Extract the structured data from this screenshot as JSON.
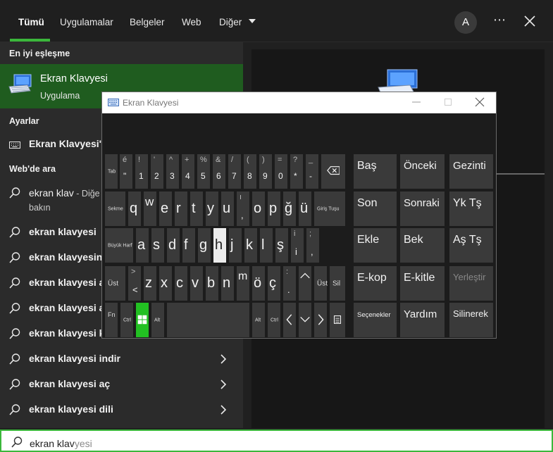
{
  "search": {
    "tabs": [
      "Tümü",
      "Uygulamalar",
      "Belgeler",
      "Web",
      "Diğer"
    ],
    "avatar_letter": "A",
    "more_label": "⋯",
    "best_match_header": "En iyi eşleşme",
    "best_match_title": "Ekran Klavyesi",
    "best_match_subtitle": "Uygulama",
    "settings_header": "Ayarlar",
    "settings_item": "Ekran Klavyesi'n",
    "web_header": "Web'de ara",
    "web_first_query": "ekran klav",
    "web_first_suffix": " - Diğe",
    "web_first_line2": "bakın",
    "web_items": [
      "ekran klavyesi",
      "ekran klavyesini",
      "ekran klavyesi a",
      "ekran klavyesi a",
      "ekran klavyesi k",
      "ekran klavyesi indir",
      "ekran klavyesi aç",
      "ekran klavyesi dili"
    ],
    "input_typed": "ekran klav",
    "input_suggestion": "yesi"
  },
  "osk": {
    "title": "Ekran Klavyesi",
    "rows": {
      "r1": [
        {
          "w": "Tab"
        },
        {
          "m": "\"",
          "s": "é"
        },
        {
          "m": "1",
          "s": "!"
        },
        {
          "m": "2",
          "s": "'"
        },
        {
          "m": "3",
          "s": "^"
        },
        {
          "m": "4",
          "s": "+"
        },
        {
          "m": "5",
          "s": "%"
        },
        {
          "m": "6",
          "s": "&"
        },
        {
          "m": "7",
          "s": "/"
        },
        {
          "m": "8",
          "s": "("
        },
        {
          "m": "9",
          "s": ")"
        },
        {
          "m": "0",
          "s": "="
        },
        {
          "m": "*",
          "s": "?"
        },
        {
          "m": "-",
          "s": "_"
        },
        {
          "icon": "backspace"
        }
      ],
      "r2": [
        {
          "w": "Sekme"
        },
        {
          "m": "q"
        },
        {
          "m": "w"
        },
        {
          "m": "e"
        },
        {
          "m": "r"
        },
        {
          "m": "t"
        },
        {
          "m": "y"
        },
        {
          "m": "u"
        },
        {
          "m": ",",
          "s": "ı"
        },
        {
          "m": "o"
        },
        {
          "m": "p"
        },
        {
          "m": "ğ"
        },
        {
          "m": "ü"
        },
        {
          "w": "Giriş Tuşu"
        }
      ],
      "r3": [
        {
          "w": "Büyük Harf"
        },
        {
          "m": "a"
        },
        {
          "m": "s"
        },
        {
          "m": "d"
        },
        {
          "m": "f"
        },
        {
          "m": "g"
        },
        {
          "m": "h"
        },
        {
          "m": "j"
        },
        {
          "m": "k"
        },
        {
          "m": "l"
        },
        {
          "m": "ş"
        },
        {
          "m": "i",
          "s": "i"
        },
        {
          "m": ",",
          "s": ";"
        }
      ],
      "r4": [
        {
          "w": "Üst"
        },
        {
          "m": "<",
          "s": ">"
        },
        {
          "m": "z"
        },
        {
          "m": "x"
        },
        {
          "m": "c"
        },
        {
          "m": "v"
        },
        {
          "m": "b"
        },
        {
          "m": "n"
        },
        {
          "m": "m"
        },
        {
          "m": "ö"
        },
        {
          "m": "ç"
        },
        {
          "m": ".",
          "s": ":"
        },
        {
          "icon": "up"
        },
        {
          "w": "Üst"
        },
        {
          "w": "Sil"
        }
      ],
      "r5": [
        {
          "w": "Fn"
        },
        {
          "w": "Ctrl"
        },
        {
          "icon": "windows"
        },
        {
          "w": "Alt"
        },
        {
          "w": ""
        },
        {
          "w": "Alt"
        },
        {
          "w": "Ctrl"
        },
        {
          "icon": "left"
        },
        {
          "icon": "down"
        },
        {
          "icon": "right"
        },
        {
          "icon": "menu"
        }
      ]
    },
    "nav_keys": [
      [
        "Baş",
        "Önceki",
        "Gezinti"
      ],
      [
        "Son",
        "Sonraki",
        "Yk Tş"
      ],
      [
        "Ekle",
        "Bek",
        "Aş Tş"
      ],
      [
        "E-kop",
        "E-kitle",
        "Yerleştir"
      ],
      [
        "Seçenekler",
        "Yardım",
        "Silinerek"
      ]
    ]
  }
}
